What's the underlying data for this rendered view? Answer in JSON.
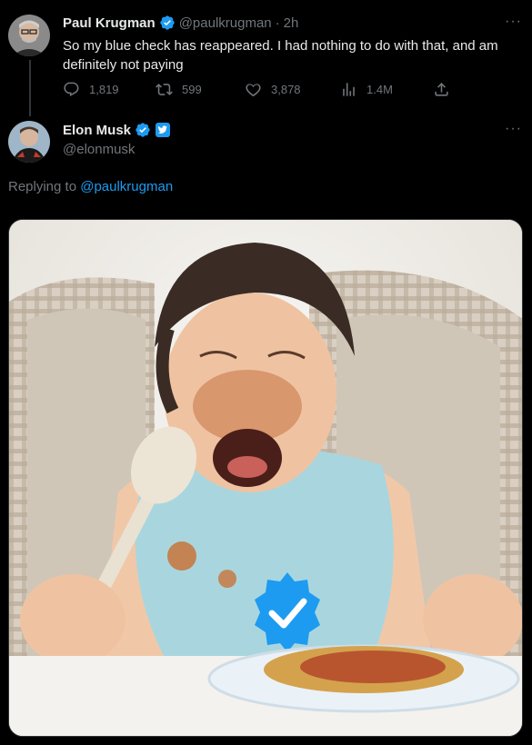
{
  "original_tweet": {
    "author_name": "Paul Krugman",
    "handle": "@paulkrugman",
    "separator": "·",
    "time": "2h",
    "text": "So my blue check has reappeared. I had nothing to do with that, and am definitely not paying",
    "more": "···",
    "metrics": {
      "replies": "1,819",
      "retweets": "599",
      "likes": "3,878",
      "views": "1.4M"
    },
    "verified": true
  },
  "reply_tweet": {
    "author_name": "Elon Musk",
    "handle": "@elonmusk",
    "more": "···",
    "verified": true,
    "replying_prefix": "Replying to",
    "replying_to": "@paulkrugman",
    "media_description": "crying toddler in high chair with spaghetti, blue checkmark badge on bib"
  },
  "icons": [
    "reply-icon",
    "retweet-icon",
    "like-icon",
    "views-icon",
    "share-icon",
    "verified-badge-icon",
    "affiliate-badge-icon",
    "more-icon"
  ],
  "colors": {
    "background": "#000000",
    "text": "#e7e9ea",
    "muted": "#71767b",
    "accent": "#1d9bf0"
  }
}
